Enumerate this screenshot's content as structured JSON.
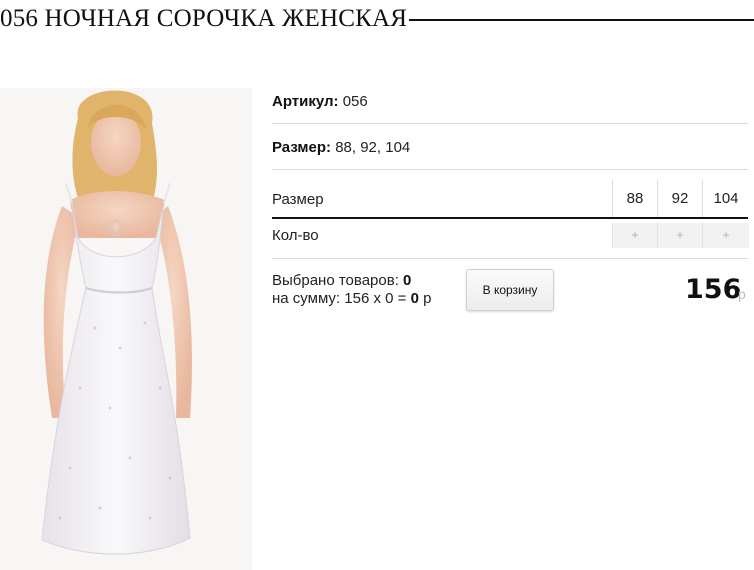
{
  "product": {
    "title": "056 НОЧНАЯ СОРОЧКА ЖЕНСКАЯ",
    "article_label": "Артикул:",
    "article_value": "056",
    "sizes_label": "Размер:",
    "sizes_value": "88, 92, 104"
  },
  "size_table": {
    "header_label": "Размер",
    "sizes": [
      "88",
      "92",
      "104"
    ],
    "qty_label": "Кол-во",
    "qty_controls": [
      "+",
      "+",
      "+"
    ]
  },
  "summary": {
    "selected_label": "Выбрано товаров:",
    "selected_count": "0",
    "sum_label": "на сумму: 156 х 0 =",
    "sum_value": "0",
    "sum_currency": "р"
  },
  "cart": {
    "button_label": "В корзину"
  },
  "price": {
    "value": "156",
    "currency": "р"
  },
  "colors": {
    "accent": "#111111",
    "separator": "#dcdcdc",
    "qty_cell": "#f1f1f1"
  }
}
